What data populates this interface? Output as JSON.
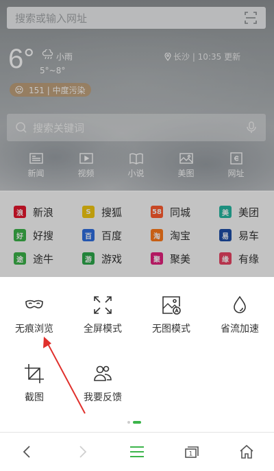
{
  "browser": {
    "url_placeholder": "搜索或输入网址",
    "search_placeholder": "搜索关键词"
  },
  "weather": {
    "temperature": "6°",
    "condition": "小雨",
    "range": "5°~8°",
    "location_update": "长沙 | 10:35 更新",
    "aqi": "151 | 中度污染"
  },
  "quick_links": [
    {
      "label": "新闻",
      "icon": "news-icon"
    },
    {
      "label": "视频",
      "icon": "video-icon"
    },
    {
      "label": "小说",
      "icon": "book-icon"
    },
    {
      "label": "美图",
      "icon": "picture-icon"
    },
    {
      "label": "网址",
      "icon": "web-icon"
    }
  ],
  "sites": [
    {
      "name": "新浪",
      "color": "#e6162d",
      "glyph": "浪"
    },
    {
      "name": "搜狐",
      "color": "#f2c811",
      "glyph": "S"
    },
    {
      "name": "同城",
      "color": "#ff5b2f",
      "glyph": "58"
    },
    {
      "name": "美团",
      "color": "#26b8a2",
      "glyph": "美"
    },
    {
      "name": "好搜",
      "color": "#3bb44a",
      "glyph": "好"
    },
    {
      "name": "百度",
      "color": "#2f6fe0",
      "glyph": "百"
    },
    {
      "name": "淘宝",
      "color": "#ff7a1a",
      "glyph": "淘"
    },
    {
      "name": "易车",
      "color": "#1e4fa8",
      "glyph": "易"
    },
    {
      "name": "途牛",
      "color": "#3bb44a",
      "glyph": "途"
    },
    {
      "name": "游戏",
      "color": "#2ca84b",
      "glyph": "游"
    },
    {
      "name": "聚美",
      "color": "#e5207d",
      "glyph": "聚"
    },
    {
      "name": "有缘",
      "color": "#e94363",
      "glyph": "缘"
    }
  ],
  "menu": {
    "items": [
      {
        "label": "无痕浏览",
        "icon": "mask-icon"
      },
      {
        "label": "全屏模式",
        "icon": "fullscreen-icon"
      },
      {
        "label": "无图模式",
        "icon": "no-image-icon"
      },
      {
        "label": "省流加速",
        "icon": "water-drop-icon"
      },
      {
        "label": "截图",
        "icon": "crop-icon"
      },
      {
        "label": "我要反馈",
        "icon": "feedback-icon"
      }
    ],
    "page_indicator": {
      "pages": 2,
      "current": 2
    }
  },
  "navbar": {
    "items": [
      "back-icon",
      "forward-icon",
      "menu-icon",
      "tabs-icon",
      "home-icon"
    ],
    "tab_count": "1",
    "accent": "#3bb44a"
  },
  "annotation": {
    "arrow_color": "#e0302c",
    "points_to": "无痕浏览"
  }
}
